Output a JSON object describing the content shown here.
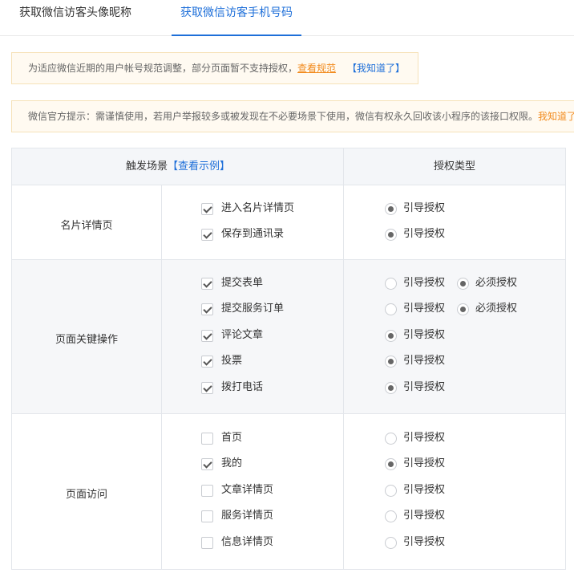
{
  "tabs": [
    {
      "label": "获取微信访客头像昵称",
      "active": false
    },
    {
      "label": "获取微信访客手机号码",
      "active": true
    }
  ],
  "notices": {
    "first": {
      "text": "为适应微信近期的用户帐号规范调整，部分页面暂不支持授权，",
      "link": "查看规范",
      "dismiss": "【我知道了】"
    },
    "second": {
      "text": "微信官方提示：需谨慎使用，若用户举报较多或被发现在不必要场景下使用，微信有权永久回收该小程序的该接口权限。",
      "link": "我知道了"
    }
  },
  "table": {
    "header": {
      "scene": "触发场景",
      "example_link": "【查看示例】",
      "auth_type": "授权类型"
    },
    "sections": [
      {
        "label": "名片详情页",
        "rows": [
          {
            "label": "进入名片详情页",
            "checked": true,
            "options": [
              {
                "label": "引导授权",
                "selected": true
              }
            ]
          },
          {
            "label": "保存到通讯录",
            "checked": true,
            "options": [
              {
                "label": "引导授权",
                "selected": true
              }
            ]
          }
        ]
      },
      {
        "label": "页面关键操作",
        "rows": [
          {
            "label": "提交表单",
            "checked": true,
            "options": [
              {
                "label": "引导授权",
                "selected": false
              },
              {
                "label": "必须授权",
                "selected": true
              }
            ]
          },
          {
            "label": "提交服务订单",
            "checked": true,
            "options": [
              {
                "label": "引导授权",
                "selected": false
              },
              {
                "label": "必须授权",
                "selected": true
              }
            ]
          },
          {
            "label": "评论文章",
            "checked": true,
            "options": [
              {
                "label": "引导授权",
                "selected": true
              }
            ]
          },
          {
            "label": "投票",
            "checked": true,
            "options": [
              {
                "label": "引导授权",
                "selected": true
              }
            ]
          },
          {
            "label": "拨打电话",
            "checked": true,
            "options": [
              {
                "label": "引导授权",
                "selected": true
              }
            ]
          }
        ]
      },
      {
        "label": "页面访问",
        "rows": [
          {
            "label": "首页",
            "checked": false,
            "options": [
              {
                "label": "引导授权",
                "selected": false
              }
            ]
          },
          {
            "label": "我的",
            "checked": true,
            "options": [
              {
                "label": "引导授权",
                "selected": true
              }
            ]
          },
          {
            "label": "文章详情页",
            "checked": false,
            "options": [
              {
                "label": "引导授权",
                "selected": false
              }
            ]
          },
          {
            "label": "服务详情页",
            "checked": false,
            "options": [
              {
                "label": "引导授权",
                "selected": false
              }
            ]
          },
          {
            "label": "信息详情页",
            "checked": false,
            "options": [
              {
                "label": "引导授权",
                "selected": false
              }
            ]
          }
        ]
      }
    ]
  },
  "colors": {
    "accent": "#1e6fd9",
    "warning_link": "#f28b1e",
    "notice_bg": "#fffaf1"
  }
}
